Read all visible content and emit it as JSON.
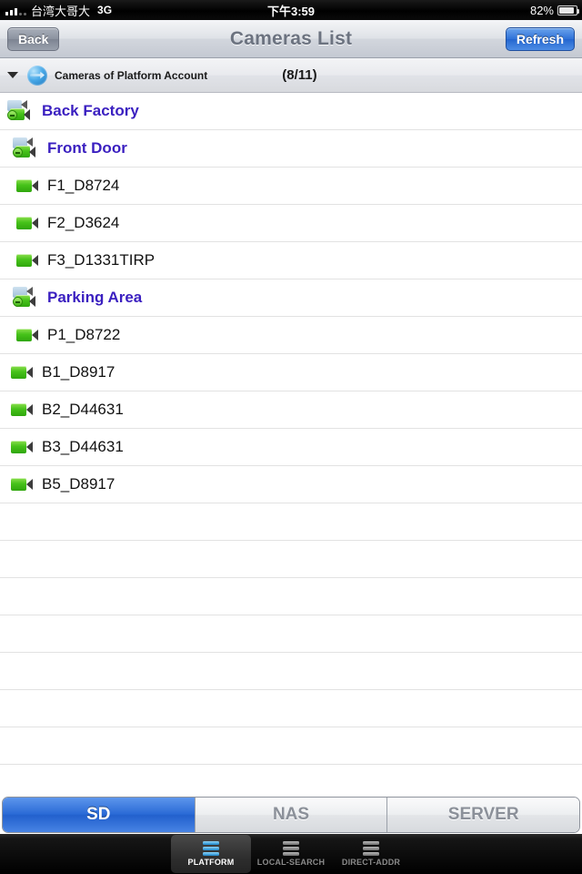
{
  "status_bar": {
    "signal_icon": "signal-bars-icon",
    "carrier": "台湾大哥大",
    "network": "3G",
    "time": "下午3:59",
    "battery_percent": "82%",
    "battery_icon": "battery-icon"
  },
  "nav_bar": {
    "back_label": "Back",
    "title": "Cameras List",
    "refresh_label": "Refresh"
  },
  "section_header": {
    "disclosure_icon": "chevron-down-icon",
    "globe_icon": "globe-icon",
    "title": "Cameras of Platform Account",
    "count": "(8/11)"
  },
  "list": {
    "rows": [
      {
        "label": "Back Factory",
        "type": "group",
        "indent": 0,
        "icon": "camera-group-icon"
      },
      {
        "label": "Front Door",
        "type": "group",
        "indent": 1,
        "icon": "camera-group-icon"
      },
      {
        "label": "F1_D8724",
        "type": "camera",
        "indent": 2,
        "icon": "camera-icon"
      },
      {
        "label": "F2_D3624",
        "type": "camera",
        "indent": 2,
        "icon": "camera-icon"
      },
      {
        "label": "F3_D1331TIRP",
        "type": "camera",
        "indent": 2,
        "icon": "camera-icon"
      },
      {
        "label": "Parking Area",
        "type": "group",
        "indent": 1,
        "icon": "camera-group-icon"
      },
      {
        "label": "P1_D8722",
        "type": "camera",
        "indent": 2,
        "icon": "camera-icon"
      },
      {
        "label": "B1_D8917",
        "type": "camera",
        "indent": 1,
        "icon": "camera-icon"
      },
      {
        "label": "B2_D44631",
        "type": "camera",
        "indent": 1,
        "icon": "camera-icon"
      },
      {
        "label": "B3_D44631",
        "type": "camera",
        "indent": 1,
        "icon": "camera-icon"
      },
      {
        "label": "B5_D8917",
        "type": "camera",
        "indent": 1,
        "icon": "camera-icon"
      }
    ],
    "empty_row_count": 8
  },
  "segmented_control": {
    "options": [
      "SD",
      "NAS",
      "SERVER"
    ],
    "selected": "SD"
  },
  "tab_bar": {
    "tabs": [
      {
        "label": "PLATFORM",
        "icon": "stack-icon",
        "active": true
      },
      {
        "label": "LOCAL-SEARCH",
        "icon": "stack-icon",
        "active": false
      },
      {
        "label": "DIRECT-ADDR",
        "icon": "stack-icon",
        "active": false
      }
    ]
  },
  "colors": {
    "accent_blue": "#2a6ad6",
    "group_text": "#3a1fc0",
    "camera_green": "#46c21a",
    "nav_title": "#6c7380"
  }
}
